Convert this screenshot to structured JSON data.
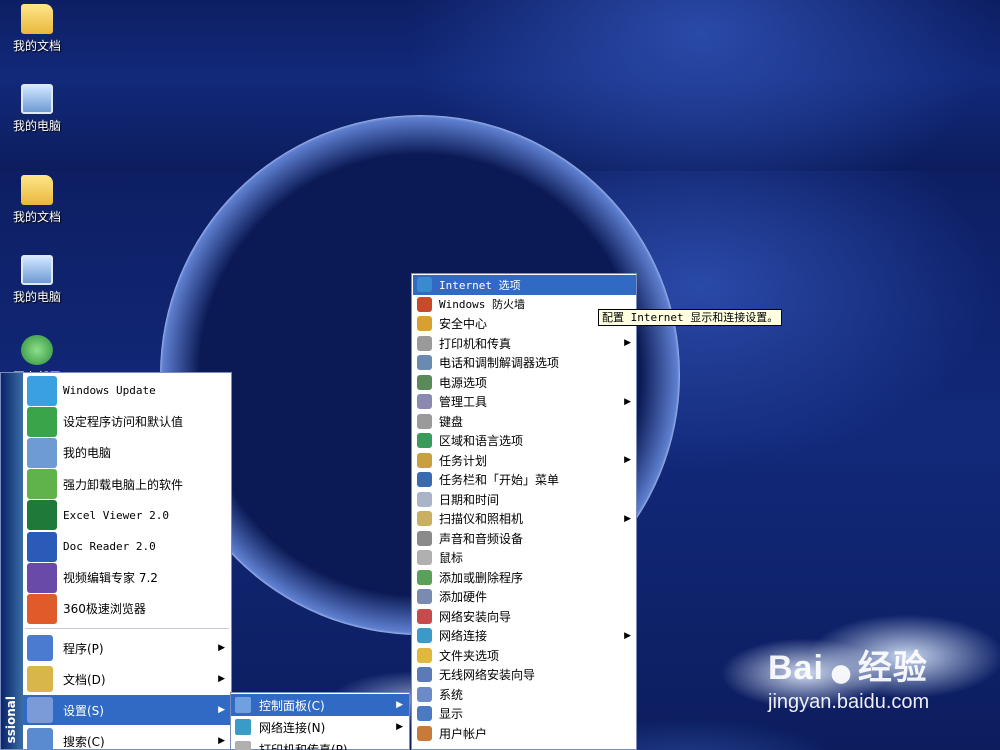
{
  "desktop": {
    "icons_top": [
      {
        "label": "我的文档",
        "icon": "folder-icon"
      },
      {
        "label": "我的电脑",
        "icon": "computer-icon"
      }
    ],
    "icons_bottom": [
      {
        "label": "我的文档",
        "icon": "folder-icon"
      },
      {
        "label": "我的电脑",
        "icon": "computer-icon"
      },
      {
        "label": "网上邻居",
        "icon": "network-icon"
      }
    ]
  },
  "start_menu": {
    "brand_text": "ssional",
    "pinned": [
      {
        "label": "Windows Update",
        "icon": "windows-update-icon",
        "color": "#3aa0e0"
      },
      {
        "label": "设定程序访问和默认值",
        "icon": "program-access-icon",
        "color": "#3aa44a"
      },
      {
        "label": "我的电脑",
        "icon": "computer-icon",
        "color": "#6f9bd4"
      },
      {
        "label": "强力卸载电脑上的软件",
        "icon": "uninstall-icon",
        "color": "#5fb34a"
      },
      {
        "label": "Excel Viewer 2.0",
        "icon": "excel-icon",
        "color": "#1f7a3a"
      },
      {
        "label": "Doc Reader 2.0",
        "icon": "word-icon",
        "color": "#2a5bb8"
      },
      {
        "label": "视频编辑专家 7.2",
        "icon": "video-editor-icon",
        "color": "#6a4aa8"
      },
      {
        "label": "360极速浏览器",
        "icon": "browser-360-icon",
        "color": "#e05a2a"
      }
    ],
    "sub": [
      {
        "label": "程序(P)",
        "icon": "programs-icon",
        "color": "#4a7bd0",
        "arrow": "▶"
      },
      {
        "label": "文档(D)",
        "icon": "documents-icon",
        "color": "#d9b64a",
        "arrow": "▶"
      },
      {
        "label": "设置(S)",
        "icon": "settings-icon",
        "color": "#7a9bd8",
        "arrow": "▶"
      },
      {
        "label": "搜索(C)",
        "icon": "search-icon",
        "color": "#5a8ad0",
        "arrow": "▶"
      }
    ]
  },
  "settings_menu": {
    "items": [
      {
        "label": "控制面板(C)",
        "icon": "control-panel-icon",
        "color": "#6fa0e0",
        "arrow": "▶"
      },
      {
        "label": "网络连接(N)",
        "icon": "network-connections-icon",
        "color": "#3a9ac8",
        "arrow": "▶"
      },
      {
        "label": "打印机和传真(P)",
        "icon": "printer-icon",
        "color": "#b0b0b0",
        "arrow": ""
      }
    ]
  },
  "control_panel": {
    "items": [
      {
        "label": "Internet 选项",
        "icon": "internet-options-icon",
        "color": "#3a8ad0",
        "arrow": "",
        "mono": true
      },
      {
        "label": "Windows 防火墙",
        "icon": "firewall-icon",
        "color": "#c84a2a",
        "arrow": "",
        "mono": true
      },
      {
        "label": "安全中心",
        "icon": "security-center-icon",
        "color": "#d8a030",
        "arrow": "",
        "mono": false
      },
      {
        "label": "打印机和传真",
        "icon": "printer-icon",
        "color": "#9a9a9a",
        "arrow": "▶",
        "mono": false
      },
      {
        "label": "电话和调制解调器选项",
        "icon": "phone-modem-icon",
        "color": "#6a8ab0",
        "arrow": "",
        "mono": false
      },
      {
        "label": "电源选项",
        "icon": "power-icon",
        "color": "#5a8a5a",
        "arrow": "",
        "mono": false
      },
      {
        "label": "管理工具",
        "icon": "admin-tools-icon",
        "color": "#8a8ab0",
        "arrow": "▶",
        "mono": false
      },
      {
        "label": "键盘",
        "icon": "keyboard-icon",
        "color": "#9a9a9a",
        "arrow": "",
        "mono": false
      },
      {
        "label": "区域和语言选项",
        "icon": "region-globe-icon",
        "color": "#3a9a5a",
        "arrow": "",
        "mono": false
      },
      {
        "label": "任务计划",
        "icon": "task-scheduler-icon",
        "color": "#c8a040",
        "arrow": "▶",
        "mono": false
      },
      {
        "label": "任务栏和「开始」菜单",
        "icon": "taskbar-icon",
        "color": "#3a6ab0",
        "arrow": "",
        "mono": false
      },
      {
        "label": "日期和时间",
        "icon": "clock-icon",
        "color": "#aab4c8",
        "arrow": "",
        "mono": false
      },
      {
        "label": "扫描仪和照相机",
        "icon": "scanner-icon",
        "color": "#c8b060",
        "arrow": "▶",
        "mono": false
      },
      {
        "label": "声音和音频设备",
        "icon": "speaker-icon",
        "color": "#8a8a8a",
        "arrow": "",
        "mono": false
      },
      {
        "label": "鼠标",
        "icon": "mouse-icon",
        "color": "#b0b0b0",
        "arrow": "",
        "mono": false
      },
      {
        "label": "添加或删除程序",
        "icon": "add-remove-icon",
        "color": "#5aa05a",
        "arrow": "",
        "mono": false
      },
      {
        "label": "添加硬件",
        "icon": "add-hardware-icon",
        "color": "#7a8ab0",
        "arrow": "",
        "mono": false
      },
      {
        "label": "网络安装向导",
        "icon": "network-setup-icon",
        "color": "#c84a4a",
        "arrow": "",
        "mono": false
      },
      {
        "label": "网络连接",
        "icon": "network-connections-icon",
        "color": "#3a9ac8",
        "arrow": "▶",
        "mono": false
      },
      {
        "label": "文件夹选项",
        "icon": "folder-options-icon",
        "color": "#e0b840",
        "arrow": "",
        "mono": false
      },
      {
        "label": "无线网络安装向导",
        "icon": "wireless-icon",
        "color": "#5a7ab8",
        "arrow": "",
        "mono": false
      },
      {
        "label": "系统",
        "icon": "system-icon",
        "color": "#6a8ac8",
        "arrow": "",
        "mono": false
      },
      {
        "label": "显示",
        "icon": "display-icon",
        "color": "#4a7ac0",
        "arrow": "",
        "mono": false
      },
      {
        "label": "用户帐户",
        "icon": "user-accounts-icon",
        "color": "#c87a3a",
        "arrow": "",
        "mono": false
      }
    ],
    "highlighted_index": 0
  },
  "tooltip": {
    "text": "配置 Internet 显示和连接设置。"
  },
  "watermark": {
    "logo_text": "Bai",
    "logo_suffix": "经验",
    "url": "jingyan.baidu.com"
  }
}
